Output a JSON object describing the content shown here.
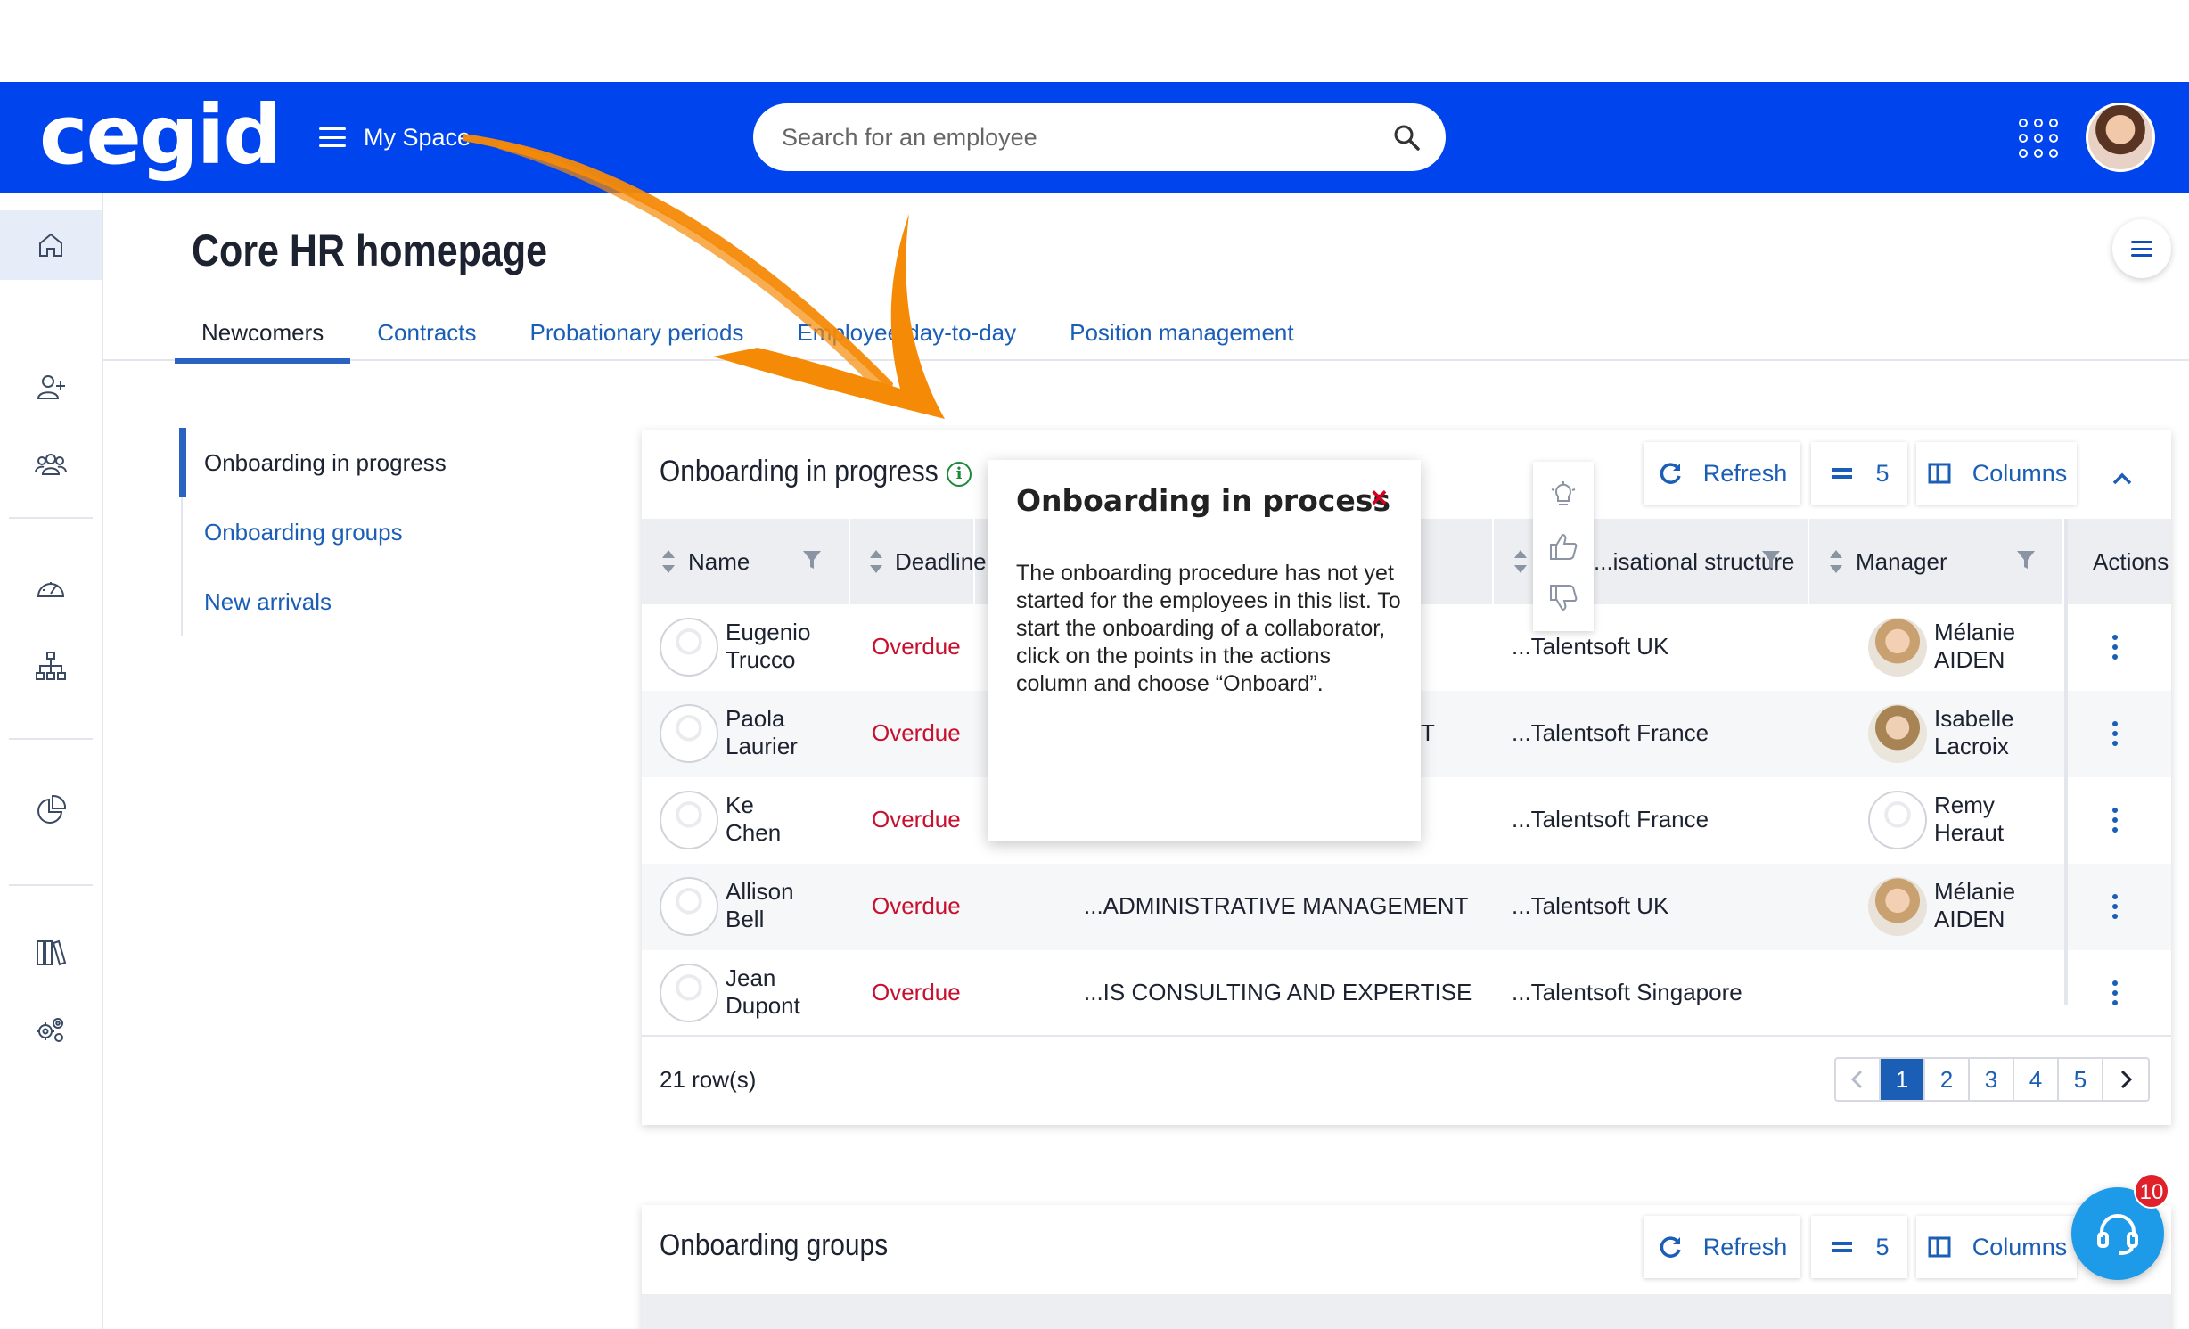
{
  "header": {
    "logo": "cegid",
    "my_space": "My Space",
    "search_placeholder": "Search for an employee"
  },
  "page": {
    "title": "Core HR homepage",
    "tabs": [
      "Newcomers",
      "Contracts",
      "Probationary periods",
      "Employee day-to-day",
      "Position management"
    ]
  },
  "sidenav": {
    "items": [
      "Onboarding in progress",
      "Onboarding groups",
      "New arrivals"
    ]
  },
  "panel1": {
    "title": "Onboarding in progress",
    "refresh": "Refresh",
    "page_size": "5",
    "columns": "Columns",
    "headers": {
      "name": "Name",
      "deadline": "Deadline",
      "org": "...isational structure",
      "manager": "Manager",
      "actions": "Actions"
    },
    "rows": [
      {
        "first": "Eugenio",
        "last": "Trucco",
        "deadline": "Overdue",
        "dept": "",
        "org": "...Talentsoft UK",
        "mgr_first": "Mélanie",
        "mgr_last": "AIDEN"
      },
      {
        "first": "Paola",
        "last": "Laurier",
        "deadline": "Overdue",
        "dept": "T",
        "org": "...Talentsoft France",
        "mgr_first": "Isabelle",
        "mgr_last": "Lacroix"
      },
      {
        "first": "Ke",
        "last": "Chen",
        "deadline": "Overdue",
        "dept": "",
        "org": "...Talentsoft France",
        "mgr_first": "Remy",
        "mgr_last": "Heraut"
      },
      {
        "first": "Allison",
        "last": "Bell",
        "deadline": "Overdue",
        "dept": "...ADMINISTRATIVE MANAGEMENT",
        "org": "...Talentsoft UK",
        "mgr_first": "Mélanie",
        "mgr_last": "AIDEN"
      },
      {
        "first": "Jean",
        "last": "Dupont",
        "deadline": "Overdue",
        "dept": "...IS CONSULTING AND EXPERTISE",
        "org": "...Talentsoft Singapore",
        "mgr_first": "",
        "mgr_last": ""
      }
    ],
    "row_count": "21 row(s)",
    "pages": [
      "1",
      "2",
      "3",
      "4",
      "5"
    ]
  },
  "popup": {
    "title": "Onboarding in process",
    "close": "×",
    "body": "The onboarding procedure has not yet started for the employees in this list. To start the onboarding of a collaborator, click on the points in the actions column and choose “Onboard”."
  },
  "panel2": {
    "title": "Onboarding groups",
    "refresh": "Refresh",
    "page_size": "5",
    "columns": "Columns"
  },
  "help": {
    "badge": "10"
  },
  "colors": {
    "brand": "#0044ee",
    "link": "#1b5eb6",
    "overdue": "#c8102e",
    "arrow": "#f58a07"
  }
}
